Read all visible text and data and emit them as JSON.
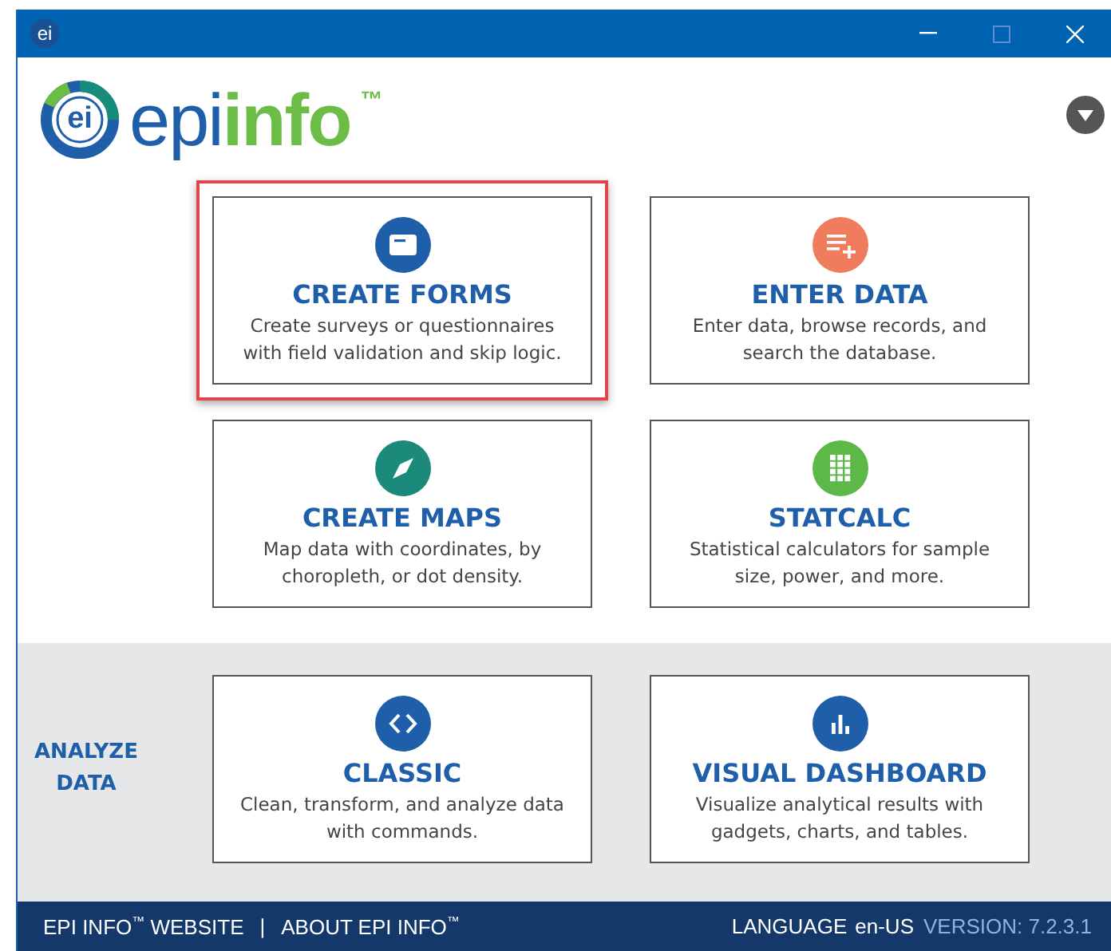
{
  "window": {
    "title": "ei"
  },
  "logo": {
    "emblem": "ei",
    "prefix": "epi",
    "name": "info",
    "mark": "™"
  },
  "tools": [
    {
      "kind": "form",
      "title": "CREATE FORMS",
      "description": "Create surveys or questionnaires with field validation and skip logic.",
      "highlighted": true
    },
    {
      "kind": "enter",
      "title": "ENTER DATA",
      "description": "Enter data, browse records, and search the database.",
      "highlighted": false
    },
    {
      "kind": "map",
      "title": "CREATE MAPS",
      "description": "Map data with coordinates, by choropleth, or dot density.",
      "highlighted": false
    },
    {
      "kind": "calc",
      "title": "STATCALC",
      "description": "Statistical calculators for sample size, power, and more.",
      "highlighted": false
    }
  ],
  "analyze": {
    "label": "ANALYZE DATA",
    "tools": [
      {
        "kind": "code",
        "title": "CLASSIC",
        "description": "Clean, transform, and analyze data with commands.",
        "highlighted": false
      },
      {
        "kind": "chart",
        "title": "VISUAL DASHBOARD",
        "description": "Visualize analytical results with gadgets, charts, and tables.",
        "highlighted": false
      }
    ]
  },
  "footer": {
    "links": [
      "EPI INFO$^{™}$ WEBSITE",
      "ABOUT EPI INFO$^{™}$"
    ],
    "separator": "|",
    "language_label": "LANGUAGE",
    "language": "en-US",
    "version": "VERSION: 7.2.3.1"
  }
}
